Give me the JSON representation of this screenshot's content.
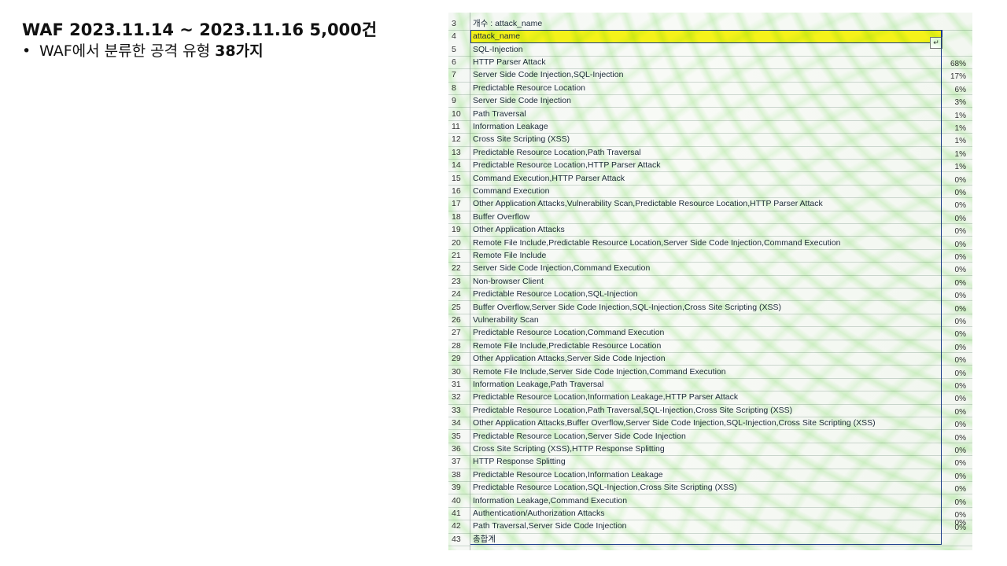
{
  "slide": {
    "title": "WAF 2023.11.14 ~ 2023.11.16 5,000건",
    "bullet_symbol": "•",
    "bullet_text_before": "WAF에서 분류한 공격 유형 ",
    "bullet_text_bold": "38가지"
  },
  "sheet": {
    "header_row": {
      "num": "3",
      "text": "개수 : attack_name"
    },
    "filter_row": {
      "num": "4",
      "text": "attack_name",
      "button_glyph": "↵"
    },
    "rows": [
      {
        "num": "5",
        "name": "SQL-Injection",
        "pct": ""
      },
      {
        "num": "6",
        "name": "HTTP Parser Attack",
        "pct": "68%"
      },
      {
        "num": "7",
        "name": "Server Side Code Injection,SQL-Injection",
        "pct": "17%"
      },
      {
        "num": "8",
        "name": "Predictable Resource Location",
        "pct": "6%"
      },
      {
        "num": "9",
        "name": "Server Side Code Injection",
        "pct": "3%"
      },
      {
        "num": "10",
        "name": "Path Traversal",
        "pct": "1%"
      },
      {
        "num": "11",
        "name": "Information Leakage",
        "pct": "1%"
      },
      {
        "num": "12",
        "name": "Cross Site Scripting (XSS)",
        "pct": "1%"
      },
      {
        "num": "13",
        "name": "Predictable Resource Location,Path Traversal",
        "pct": "1%"
      },
      {
        "num": "14",
        "name": "Predictable Resource Location,HTTP Parser Attack",
        "pct": "1%"
      },
      {
        "num": "15",
        "name": "Command Execution,HTTP Parser Attack",
        "pct": "0%"
      },
      {
        "num": "16",
        "name": "Command Execution",
        "pct": "0%"
      },
      {
        "num": "17",
        "name": "Other Application Attacks,Vulnerability Scan,Predictable Resource Location,HTTP Parser Attack",
        "pct": "0%"
      },
      {
        "num": "18",
        "name": "Buffer Overflow",
        "pct": "0%"
      },
      {
        "num": "19",
        "name": "Other Application Attacks",
        "pct": "0%"
      },
      {
        "num": "20",
        "name": "Remote File Include,Predictable Resource Location,Server Side Code Injection,Command Execution",
        "pct": "0%"
      },
      {
        "num": "21",
        "name": "Remote File Include",
        "pct": "0%"
      },
      {
        "num": "22",
        "name": "Server Side Code Injection,Command Execution",
        "pct": "0%"
      },
      {
        "num": "23",
        "name": "Non-browser Client",
        "pct": "0%"
      },
      {
        "num": "24",
        "name": "Predictable Resource Location,SQL-Injection",
        "pct": "0%"
      },
      {
        "num": "25",
        "name": "Buffer Overflow,Server Side Code Injection,SQL-Injection,Cross Site Scripting (XSS)",
        "pct": "0%"
      },
      {
        "num": "26",
        "name": "Vulnerability Scan",
        "pct": "0%"
      },
      {
        "num": "27",
        "name": "Predictable Resource Location,Command Execution",
        "pct": "0%"
      },
      {
        "num": "28",
        "name": "Remote File Include,Predictable Resource Location",
        "pct": "0%"
      },
      {
        "num": "29",
        "name": "Other Application Attacks,Server Side Code Injection",
        "pct": "0%"
      },
      {
        "num": "30",
        "name": "Remote File Include,Server Side Code Injection,Command Execution",
        "pct": "0%"
      },
      {
        "num": "31",
        "name": "Information Leakage,Path Traversal",
        "pct": "0%"
      },
      {
        "num": "32",
        "name": "Predictable Resource Location,Information Leakage,HTTP Parser Attack",
        "pct": "0%"
      },
      {
        "num": "33",
        "name": "Predictable Resource Location,Path Traversal,SQL-Injection,Cross Site Scripting (XSS)",
        "pct": "0%"
      },
      {
        "num": "34",
        "name": "Other Application Attacks,Buffer Overflow,Server Side Code Injection,SQL-Injection,Cross Site Scripting (XSS)",
        "pct": "0%"
      },
      {
        "num": "35",
        "name": "Predictable Resource Location,Server Side Code Injection",
        "pct": "0%"
      },
      {
        "num": "36",
        "name": "Cross Site Scripting (XSS),HTTP Response Splitting",
        "pct": "0%"
      },
      {
        "num": "37",
        "name": "HTTP Response Splitting",
        "pct": "0%"
      },
      {
        "num": "38",
        "name": "Predictable Resource Location,Information Leakage",
        "pct": "0%"
      },
      {
        "num": "39",
        "name": "Predictable Resource Location,SQL-Injection,Cross Site Scripting (XSS)",
        "pct": "0%"
      },
      {
        "num": "40",
        "name": "Information Leakage,Command Execution",
        "pct": "0%"
      },
      {
        "num": "41",
        "name": "Authentication/Authorization Attacks",
        "pct": "0%"
      },
      {
        "num": "42",
        "name": "Path Traversal,Server Side Code Injection",
        "pct": "0%"
      },
      {
        "num": "43",
        "name": "총합계",
        "pct": ""
      }
    ],
    "extra_pct": [
      "0%"
    ],
    "highlight_color": "#f5f21a",
    "border_color": "#1b3a8a"
  }
}
